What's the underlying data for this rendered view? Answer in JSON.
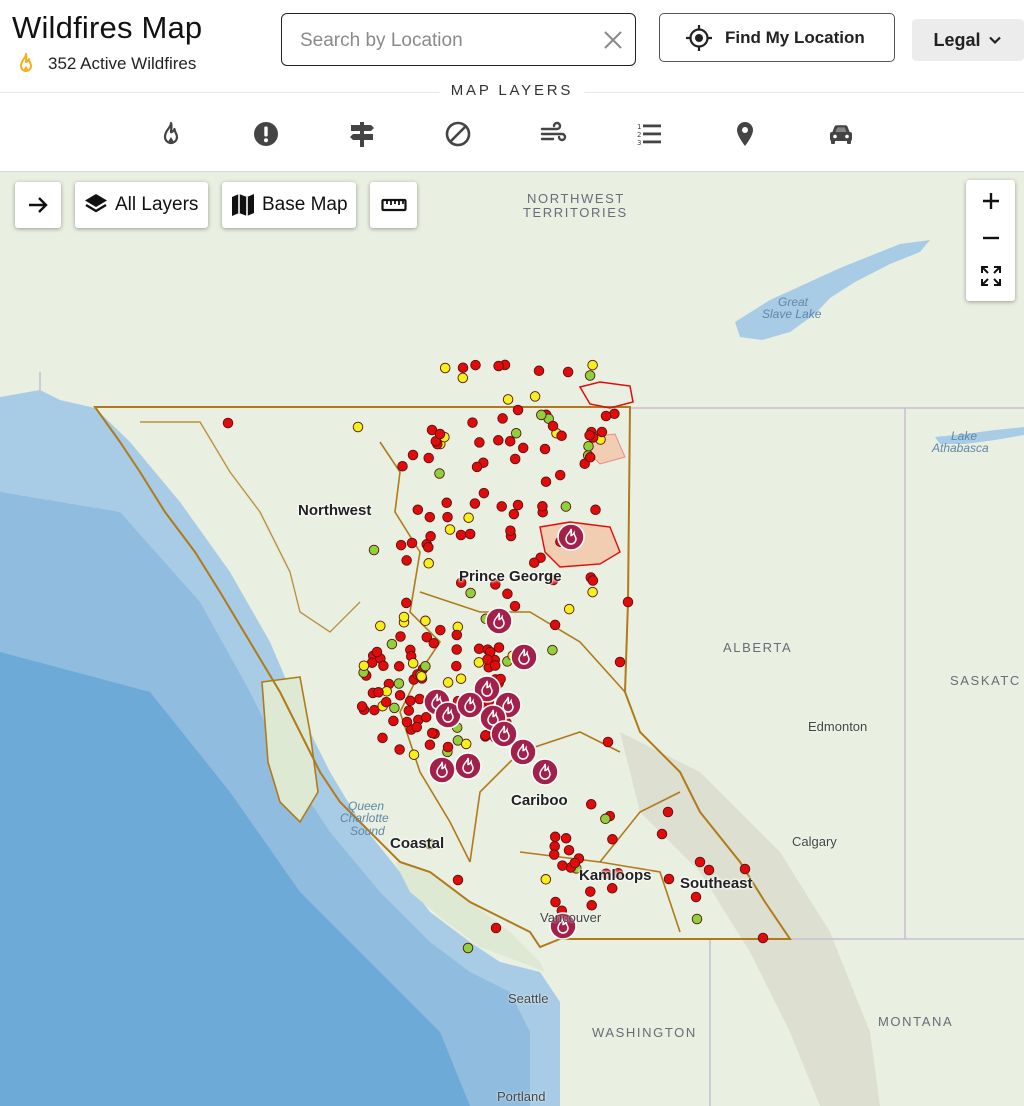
{
  "header": {
    "title": "Wildfires Map",
    "active_count": "352 Active Wildfires",
    "search_placeholder": "Search by Location",
    "find_location_label": "Find My Location",
    "legal_label": "Legal"
  },
  "layers_bar": {
    "label": "MAP LAYERS",
    "icons": [
      "fire-icon",
      "alert-icon",
      "signpost-icon",
      "ban-icon",
      "wind-icon",
      "list-icon",
      "location-pin-icon",
      "car-icon"
    ]
  },
  "map_toolbar": {
    "all_layers_label": "All Layers",
    "base_map_label": "Base Map"
  },
  "fire_centres": {
    "northwest": "Northwest",
    "prince_george": "Prince George",
    "cariboo": "Cariboo",
    "coastal": "Coastal",
    "kamloops": "Kamloops",
    "southeast": "Southeast"
  },
  "geo_labels": {
    "nwt_line1": "NORTHWEST",
    "nwt_line2": "TERRITORIES",
    "alberta": "ALBERTA",
    "saskatchewan": "SASKATC",
    "washington": "WASHINGTON",
    "montana": "MONTANA",
    "great_slave_1": "Great",
    "great_slave_2": "Slave Lake",
    "lake_athabasca_1": "Lake",
    "lake_athabasca_2": "Athabasca",
    "queen_charlotte_1": "Queen",
    "queen_charlotte_2": "Charlotte",
    "queen_charlotte_3": "Sound"
  },
  "cities": {
    "edmonton": "Edmonton",
    "calgary": "Calgary",
    "seattle": "Seattle",
    "portland": "Portland",
    "vancouver": "Vancouver"
  },
  "colors": {
    "fire_red": "#e10b0b",
    "fire_yellow": "#f2f21a",
    "fire_green": "#8fd13a",
    "fire_of_note": "#a3204a",
    "boundary": "#b07a1a",
    "flame_icon": "#f2b01e"
  }
}
